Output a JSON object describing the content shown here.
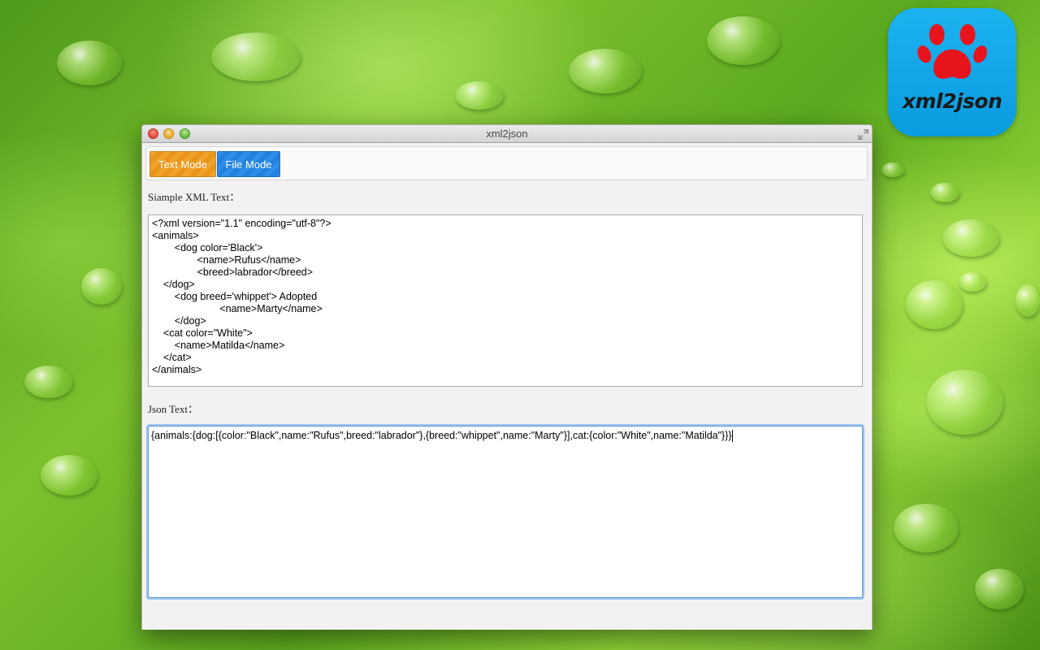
{
  "app_icon": {
    "label": "xml2json"
  },
  "window": {
    "title": "xml2json",
    "tabs": [
      {
        "label": "Text Mode",
        "active": true,
        "color": "#f0a22a"
      },
      {
        "label": "File Mode",
        "active": false,
        "color": "#2e8ee8"
      }
    ],
    "xml_label": "Siample XML Text：",
    "xml_text": "<?xml version=\"1.1\" encoding=\"utf-8\"?>\n<animals>\n        <dog color='Black'>\n                <name>Rufus</name>\n                <breed>labrador</breed>\n    </dog>\n        <dog breed='whippet'> Adopted\n                        <name>Marty</name>\n        </dog>\n    <cat color=\"White\">\n        <name>Matilda</name>\n    </cat>\n</animals>",
    "json_label": "Json Text：",
    "json_text": "{animals:{dog:[{color:\"Black\",name:\"Rufus\",breed:\"labrador\"},{breed:\"whippet\",name:\"Marty\"}],cat:{color:\"White\",name:\"Matilda\"}}}"
  }
}
